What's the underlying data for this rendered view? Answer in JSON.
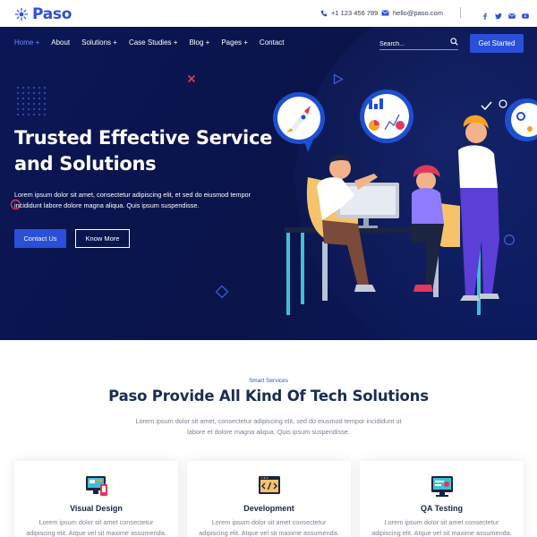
{
  "brand": {
    "name": "Paso",
    "color": "#2b4fd8"
  },
  "topbar": {
    "phone": "+1 123 456 789",
    "email": "hello@paso.com",
    "social_icons": [
      "facebook-icon",
      "twitter-icon",
      "email-icon",
      "youtube-icon"
    ]
  },
  "nav": {
    "items": [
      {
        "label": "Home +",
        "active": true
      },
      {
        "label": "About",
        "active": false
      },
      {
        "label": "Solutions +",
        "active": false
      },
      {
        "label": "Case Studies +",
        "active": false
      },
      {
        "label": "Blog +",
        "active": false
      },
      {
        "label": "Pages +",
        "active": false
      },
      {
        "label": "Contact",
        "active": false
      }
    ],
    "search_placeholder": "Search...",
    "cta_label": "Get Started"
  },
  "hero": {
    "title": "Trusted Effective Service and Solutions",
    "description": "Lorem ipsum dolor sit amet, consectetur adipiscing elit, et sed do eiusmod tempor incididunt labore dolore magna aliqua. Quis ipsum suspendisse.",
    "primary_button": "Contact Us",
    "secondary_button": "Know More",
    "background_color": "#0b1656"
  },
  "services": {
    "eyebrow": "Smart Services",
    "title": "Paso Provide All Kind Of Tech Solutions",
    "description": "Lorem ipsum dolor sit amet, consectetur adipiscing elit, sed do eiusmod tempor incididunt ut labore et dolore magna aliqua. Quis ipsum suspendisse.",
    "cards": [
      {
        "title": "Visual Design",
        "text": "Lorem ipsum dolor sit amet consectetur adipiscing elit. Atque vel sit maxime assumenda.",
        "icon": "visual-design-icon"
      },
      {
        "title": "Development",
        "text": "Lorem ipsum dolor sit amet consectetur adipiscing elit. Atque vel sit maxime assumenda.",
        "icon": "development-icon"
      },
      {
        "title": "QA Testing",
        "text": "Lorem ipsum dolor sit amet consectetur adipiscing elit. Atque vel sit maxime assumenda.",
        "icon": "qa-testing-icon"
      }
    ]
  }
}
